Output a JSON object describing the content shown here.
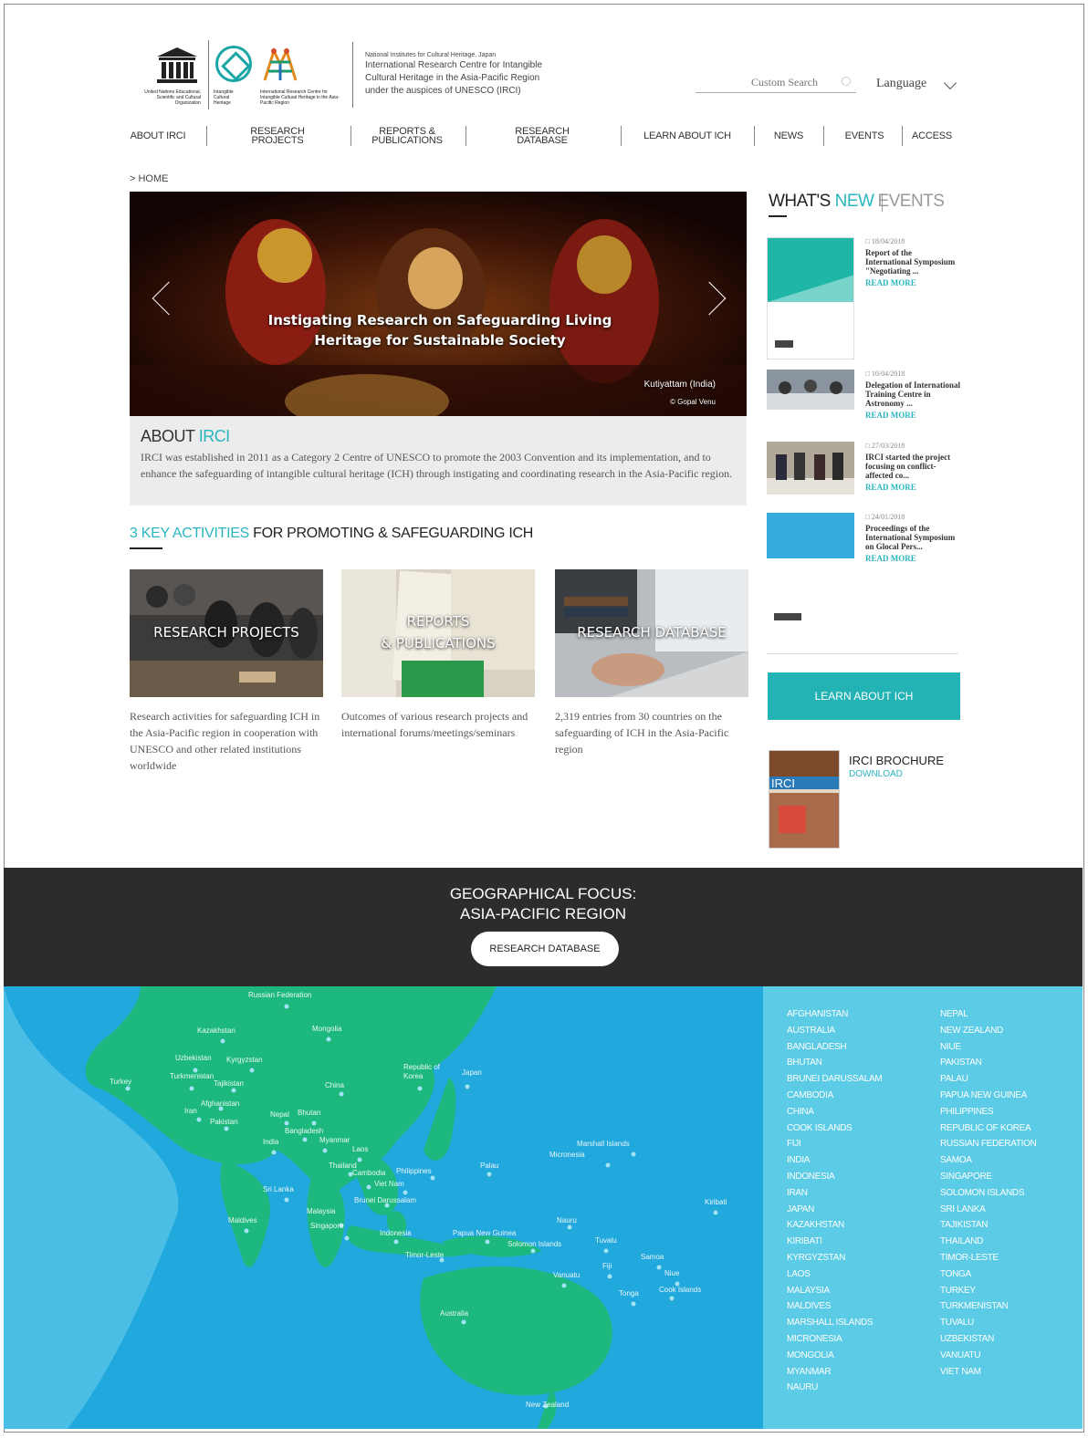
{
  "header": {
    "unesco_text": "United Nations Educational, Scientific and Cultural Organization",
    "ich_text": "Intangible Cultural Heritage",
    "irci_text": "International Research Centre for Intangible Cultural Heritage in the Asia-Pacific Region",
    "inst_small": "National Institutes for Cultural Heritage, Japan",
    "inst_main": "International Research Centre for Intangible Cultural Heritage in the Asia-Pacific Region under the auspices of UNESCO (IRCI)",
    "search_placeholder": "Custom Search",
    "language": "Language"
  },
  "nav": [
    "ABOUT IRCI",
    "RESEARCH PROJECTS",
    "REPORTS & PUBLICATIONS",
    "RESEARCH DATABASE",
    "LEARN ABOUT ICH",
    "NEWS",
    "EVENTS",
    "ACCESS"
  ],
  "breadcrumb": "> HOME",
  "hero": {
    "title": "Instigating Research on Safeguarding Living Heritage for Sustainable Society",
    "caption": "Kutiyattam (India)",
    "credit": "© Gopal Venu"
  },
  "about": {
    "title_a": "ABOUT ",
    "title_b": "IRCI",
    "text": "IRCI was established in 2011 as a Category 2 Centre of UNESCO to promote the 2003 Convention and its implementation, and to enhance the safeguarding of intangible cultural heritage (ICH) through instigating and coordinating research in the Asia-Pacific region."
  },
  "key": {
    "hl": "3 KEY ACTIVITIES",
    "rest": " FOR PROMOTING & SAFEGUARDING ICH"
  },
  "cards": [
    {
      "label": "RESEARCH PROJECTS",
      "desc": "Research activities for safeguarding ICH in the Asia-Pacific region in cooperation with UNESCO and other related institutions worldwide"
    },
    {
      "label1": "REPORTS",
      "label2": "& PUBLICATIONS",
      "desc": "Outcomes of various research projects and international forums/meetings/seminars"
    },
    {
      "label": "RESEARCH DATABASE",
      "desc": "2,319 entries from 30 countries on the safeguarding of ICH in the Asia-Pacific region"
    }
  ],
  "whats_new": {
    "a": "WHAT'S ",
    "b": "NEW",
    "c": "EVENTS"
  },
  "news": [
    {
      "date": "18/04/2018",
      "title": "Report of the International Symposium \"Negotiating ...",
      "more": "READ MORE"
    },
    {
      "date": "10/04/2018",
      "title": "Delegation of International Training Centre in Astronomy ...",
      "more": "READ MORE"
    },
    {
      "date": "27/03/2018",
      "title": "IRCI started the project focusing on conflict-affected co...",
      "more": "READ MORE"
    },
    {
      "date": "24/01/2018",
      "title": "Proceedings of the International Symposium on Glocal Pers...",
      "more": "READ MORE"
    }
  ],
  "learn_btn": "LEARN ABOUT ICH",
  "brochure": {
    "title": "IRCI BROCHURE",
    "download": "DOWNLOAD",
    "logo": "IRCI"
  },
  "geo": {
    "line1": "GEOGRAPHICAL FOCUS:",
    "line2": "ASIA-PACIFIC REGION",
    "button": "RESEARCH DATABASE"
  },
  "map_labels": [
    "Russian Federation",
    "Kazakhstan",
    "Mongolia",
    "Uzbekistan",
    "Kyrgyzstan",
    "Turkmenistan",
    "Tajikistan",
    "Turkey",
    "Afghanistan",
    "Iran",
    "Pakistan",
    "Nepal",
    "Bhutan",
    "China",
    "Republic of Korea",
    "Japan",
    "Bangladesh",
    "India",
    "Myanmar",
    "Laos",
    "Thailand",
    "Cambodia",
    "Philippines",
    "Viet Nam",
    "Sri Lanka",
    "Brunei Darussalam",
    "Malaysia",
    "Maldives",
    "Singapore",
    "Indonesia",
    "Papua New Guinea",
    "Solomon Islands",
    "Timor-Leste",
    "Palau",
    "Micronesia",
    "Marshall Islands",
    "Nauru",
    "Tuvalu",
    "Kiribati",
    "Samoa",
    "Fiji",
    "Vanuatu",
    "Niue",
    "Tonga",
    "Cook Islands",
    "Australia",
    "New Zealand"
  ],
  "countries_left": [
    "AFGHANISTAN",
    "AUSTRALIA",
    "BANGLADESH",
    "BHUTAN",
    "BRUNEI DARUSSALAM",
    "CAMBODIA",
    "CHINA",
    "COOK ISLANDS",
    "FIJI",
    "INDIA",
    "INDONESIA",
    "IRAN",
    "JAPAN",
    "KAZAKHSTAN",
    "KIRIBATI",
    "KYRGYZSTAN",
    "LAOS",
    "MALAYSIA",
    "MALDIVES",
    "MARSHALL ISLANDS",
    "MICRONESIA",
    "MONGOLIA",
    "MYANMAR",
    "NAURU"
  ],
  "countries_right": [
    "NEPAL",
    "NEW ZEALAND",
    "NIUE",
    "PAKISTAN",
    "PALAU",
    "PAPUA NEW GUINEA",
    "PHILIPPINES",
    "REPUBLIC OF KOREA",
    "RUSSIAN FEDERATION",
    "SAMOA",
    "SINGAPORE",
    "SOLOMON ISLANDS",
    "SRI LANKA",
    "TAJIKISTAN",
    "THAILAND",
    "TIMOR-LESTE",
    "TONGA",
    "TURKEY",
    "TURKMENISTAN",
    "TUVALU",
    "UZBEKISTAN",
    "VANUATU",
    "VIET NAM"
  ],
  "colors": {
    "accent": "#2bb6bf",
    "button": "#24b3b5",
    "dark": "#2c2c2c",
    "ocean": "#21a8dc",
    "land": "#1db87e",
    "list_bg": "#5bcbe6"
  }
}
